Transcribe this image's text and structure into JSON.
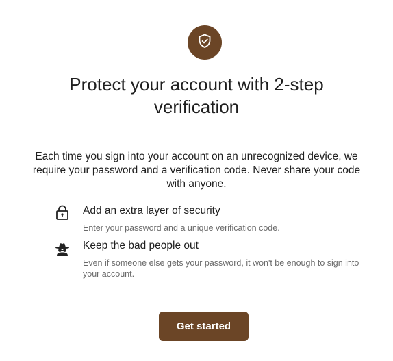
{
  "dialog": {
    "title": "Protect your account with 2-step verification",
    "description": "Each time you sign into your account on an unrecognized device, we require your password and a verification code. Never share your code with anyone.",
    "badge_icon": "shield-check-icon"
  },
  "features": [
    {
      "icon": "lock-icon",
      "title": "Add an extra layer of security",
      "description": "Enter your password and a unique verification code."
    },
    {
      "icon": "spy-icon",
      "title": "Keep the bad people out",
      "description": "Even if someone else gets your password, it won't be enough to sign into your account."
    }
  ],
  "actions": {
    "get_started_label": "Get started"
  },
  "colors": {
    "accent": "#6b4526",
    "text": "#1f1f1f",
    "muted": "#6a6a6a"
  }
}
